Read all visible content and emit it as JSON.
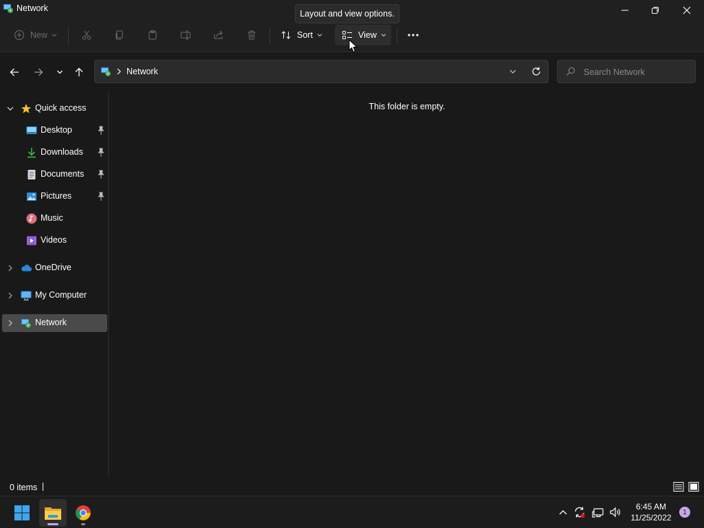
{
  "window": {
    "title": "Network",
    "icon": "network-icon",
    "controls": {
      "minimize": "minimize-icon",
      "maximize": "restore-icon",
      "close": "close-icon"
    }
  },
  "toolbar": {
    "new_label": "New",
    "sort_label": "Sort",
    "view_label": "View",
    "more": "more-icon",
    "tooltip": "Layout and view options."
  },
  "address": {
    "crumb": "Network",
    "search_placeholder": "Search Network"
  },
  "sidebar": {
    "quick_access": "Quick access",
    "items": [
      {
        "label": "Desktop",
        "icon": "desktop-icon",
        "pinned": true
      },
      {
        "label": "Downloads",
        "icon": "downloads-icon",
        "pinned": true
      },
      {
        "label": "Documents",
        "icon": "documents-icon",
        "pinned": true
      },
      {
        "label": "Pictures",
        "icon": "pictures-icon",
        "pinned": true
      },
      {
        "label": "Music",
        "icon": "music-icon",
        "pinned": false
      },
      {
        "label": "Videos",
        "icon": "videos-icon",
        "pinned": false
      }
    ],
    "onedrive": "OneDrive",
    "my_computer": "My Computer",
    "network": "Network"
  },
  "content": {
    "empty_message": "This folder is empty."
  },
  "status": {
    "item_count": "0 items"
  },
  "taskbar": {
    "apps": [
      "start-icon",
      "file-explorer-icon",
      "chrome-icon"
    ],
    "time": "6:45 AM",
    "date": "11/25/2022",
    "notifications": "1"
  },
  "colors": {
    "background": "#191919",
    "chrome": "#202020",
    "selected": "#4a4a4a",
    "accent": "#4cc2ff"
  }
}
